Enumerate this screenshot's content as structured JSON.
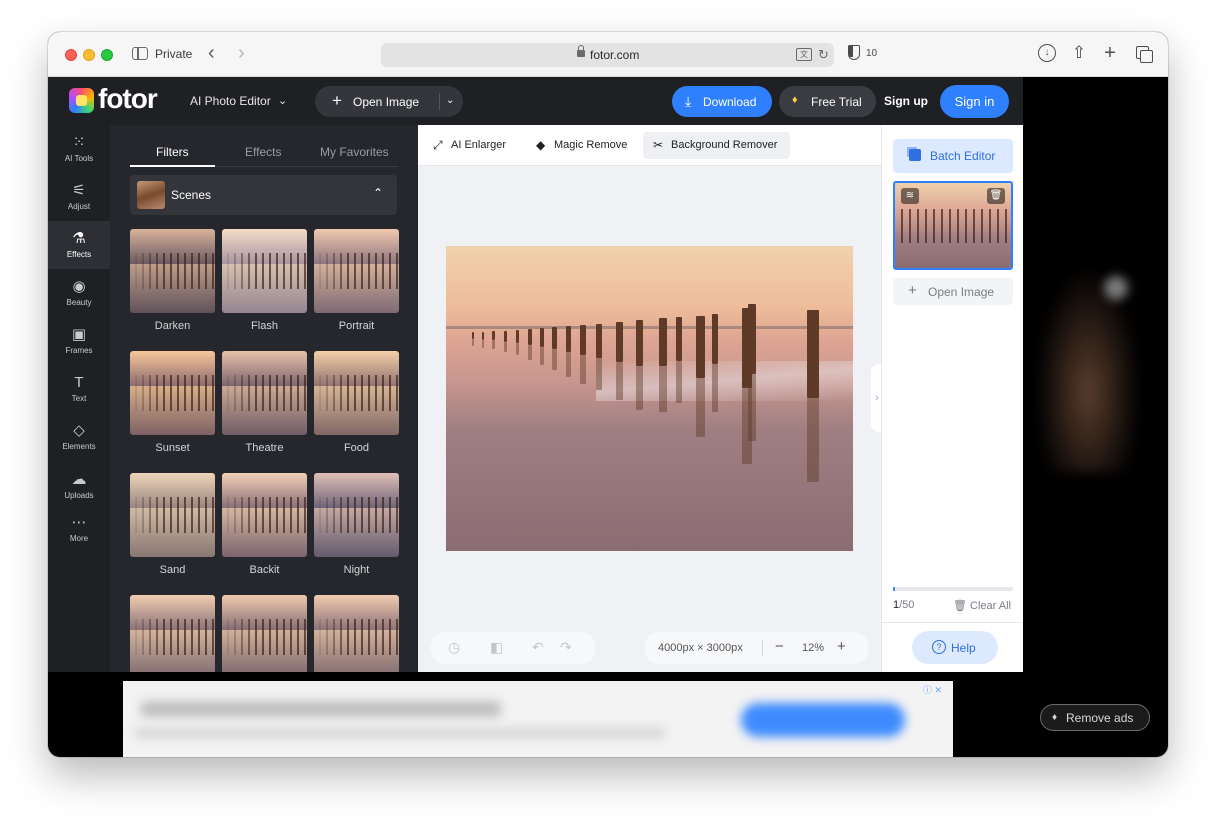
{
  "browser": {
    "mode_label": "Private",
    "url": "fotor.com",
    "tracker_count": "10"
  },
  "header": {
    "logo_text": "fotor",
    "product_select": "AI Photo Editor",
    "open_image_label": "Open Image",
    "download_label": "Download",
    "free_trial_label": "Free Trial",
    "sign_up_label": "Sign up",
    "sign_in_label": "Sign in"
  },
  "rail": {
    "items": [
      {
        "label": "AI Tools",
        "icon": "grid-dots-icon"
      },
      {
        "label": "Adjust",
        "icon": "sliders-icon"
      },
      {
        "label": "Effects",
        "icon": "flask-icon"
      },
      {
        "label": "Beauty",
        "icon": "eye-icon"
      },
      {
        "label": "Frames",
        "icon": "frame-icon"
      },
      {
        "label": "Text",
        "icon": "text-icon"
      },
      {
        "label": "Elements",
        "icon": "shapes-icon"
      },
      {
        "label": "Uploads",
        "icon": "cloud-upload-icon"
      },
      {
        "label": "More",
        "icon": "more-icon"
      }
    ],
    "active": "Effects"
  },
  "panel": {
    "tabs": [
      {
        "label": "Filters"
      },
      {
        "label": "Effects"
      },
      {
        "label": "My Favorites"
      }
    ],
    "active_tab": "Filters",
    "section_title": "Scenes",
    "filters": [
      {
        "name": "Darken",
        "tint_top": "#d9b29a",
        "tint_bottom": "#6a5a62"
      },
      {
        "name": "Flash",
        "tint_top": "#f5dcc8",
        "tint_bottom": "#a895a0"
      },
      {
        "name": "Portrait",
        "tint_top": "#f0c8ae",
        "tint_bottom": "#8e7680"
      },
      {
        "name": "Sunset",
        "tint_top": "#f7c79a",
        "tint_bottom": "#8c6a6e"
      },
      {
        "name": "Theatre",
        "tint_top": "#e7c0a8",
        "tint_bottom": "#7d6670"
      },
      {
        "name": "Food",
        "tint_top": "#f4cfa8",
        "tint_bottom": "#917372"
      },
      {
        "name": "Sand",
        "tint_top": "#eed4b8",
        "tint_bottom": "#9a8580"
      },
      {
        "name": "Backit",
        "tint_top": "#f2d0b6",
        "tint_bottom": "#8a7079"
      },
      {
        "name": "Night",
        "tint_top": "#e1bfb8",
        "tint_bottom": "#6e6478"
      },
      {
        "name": "",
        "tint_top": "#f1cdb0",
        "tint_bottom": "#8b727a"
      },
      {
        "name": "",
        "tint_top": "#eec9ad",
        "tint_bottom": "#876e76"
      },
      {
        "name": "",
        "tint_top": "#f0cbb0",
        "tint_bottom": "#8d7378"
      }
    ]
  },
  "toolstrip": {
    "ai_enlarger_label": "AI Enlarger",
    "magic_remove_label": "Magic Remove",
    "background_remover_label": "Background Remover"
  },
  "canvas": {
    "dimensions": "4000px × 3000px",
    "zoom": "12%"
  },
  "right_panel": {
    "batch_editor_label": "Batch Editor",
    "open_image_label": "Open Image",
    "count_current": "1",
    "count_total": "/50",
    "progress_fraction": 0.02,
    "clear_all_label": "Clear All",
    "help_label": "Help"
  },
  "ad": {
    "remove_ads_label": "Remove ads"
  },
  "colors": {
    "accent": "#2f80ff",
    "topbar": "#1f2024",
    "panel": "#26272c"
  }
}
